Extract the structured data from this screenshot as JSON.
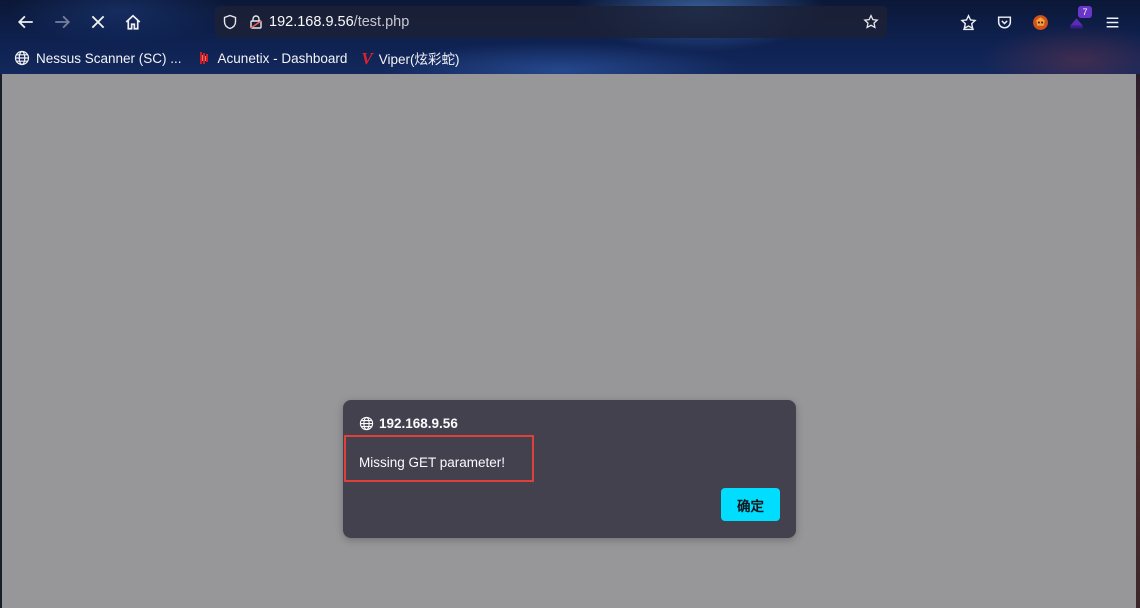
{
  "browser": {
    "url_host": "192.168.9.56",
    "url_path": "/test.php",
    "extension_badge": "7"
  },
  "bookmarks": [
    {
      "label": "Nessus Scanner (SC) ...",
      "icon": "globe-icon"
    },
    {
      "label": "Acunetix - Dashboard",
      "icon": "acunetix-icon"
    },
    {
      "label": "Viper(炫彩蛇)",
      "icon": "viper-icon"
    }
  ],
  "dialog": {
    "origin": "192.168.9.56",
    "message": "Missing GET parameter!",
    "ok_label": "确定",
    "ok_color": "#00ddff",
    "highlight_color": "#e0403a"
  },
  "colors": {
    "page_bg": "#979799",
    "dialog_bg": "#42414d"
  }
}
